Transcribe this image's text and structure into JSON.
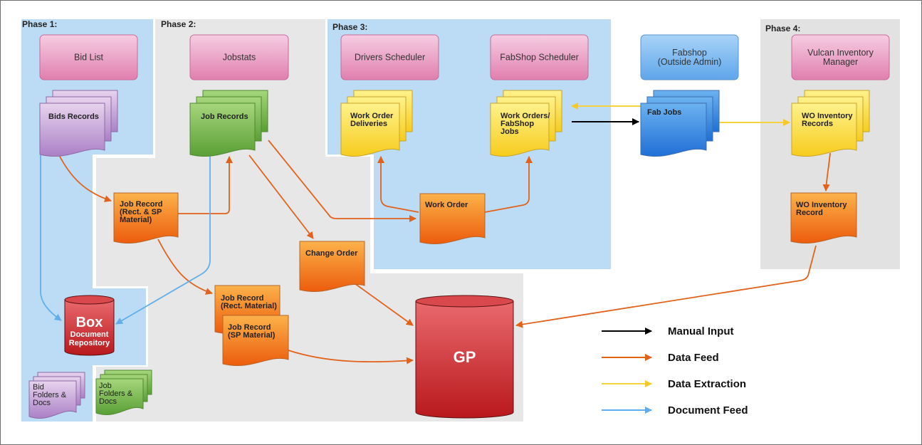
{
  "phases": [
    {
      "id": "phase1",
      "label": "Phase 1:",
      "color": "#bcdcf5"
    },
    {
      "id": "phase2",
      "label": "Phase 2:",
      "color": "#e7e7e7"
    },
    {
      "id": "phase3",
      "label": "Phase 3:",
      "color": "#bcdcf5"
    },
    {
      "id": "phase4",
      "label": "Phase 4:",
      "color": "#e2e2e2"
    }
  ],
  "systems": [
    {
      "id": "bid-list",
      "label": [
        "Bid List"
      ],
      "kind": "pink"
    },
    {
      "id": "jobstats",
      "label": [
        "Jobstats"
      ],
      "kind": "pink"
    },
    {
      "id": "drivers-scheduler",
      "label": [
        "Drivers Scheduler"
      ],
      "kind": "pink"
    },
    {
      "id": "fabshop-scheduler",
      "label": [
        "FabShop Scheduler"
      ],
      "kind": "pink"
    },
    {
      "id": "fabshop",
      "label": [
        "Fabshop",
        "(Outside Admin)"
      ],
      "kind": "blue"
    },
    {
      "id": "vulcan-inventory-manager",
      "label": [
        "Vulcan Inventory",
        "Manager"
      ],
      "kind": "pink"
    }
  ],
  "documents": [
    {
      "id": "bids-records",
      "label": [
        "Bids Records"
      ],
      "kind": "purple",
      "stacked": true
    },
    {
      "id": "job-records",
      "label": [
        "Job Records"
      ],
      "kind": "green",
      "stacked": true
    },
    {
      "id": "work-order-deliveries",
      "label": [
        "Work Order",
        "Deliveries"
      ],
      "kind": "yellow",
      "stacked": true
    },
    {
      "id": "work-orders-fabshop-jobs",
      "label": [
        "Work Orders/",
        "FabShop",
        "Jobs"
      ],
      "kind": "yellow",
      "stacked": true
    },
    {
      "id": "fab-jobs",
      "label": [
        "Fab Jobs"
      ],
      "kind": "blue",
      "stacked": true
    },
    {
      "id": "wo-inventory-records",
      "label": [
        "WO Inventory",
        "Records"
      ],
      "kind": "yellow",
      "stacked": true
    },
    {
      "id": "job-record-rect-sp",
      "label": [
        "Job Record",
        "(Rect. & SP",
        "Material)"
      ],
      "kind": "orange",
      "stacked": false
    },
    {
      "id": "work-order",
      "label": [
        "Work Order"
      ],
      "kind": "orange",
      "stacked": false
    },
    {
      "id": "change-order",
      "label": [
        "Change Order"
      ],
      "kind": "orange",
      "stacked": false
    },
    {
      "id": "job-record-rect",
      "label": [
        "Job Record",
        "(Rect. Material)"
      ],
      "kind": "orange",
      "stacked": false
    },
    {
      "id": "job-record-sp",
      "label": [
        "Job Record",
        "(SP Material)"
      ],
      "kind": "orange",
      "stacked": false
    },
    {
      "id": "wo-inventory-record",
      "label": [
        "WO Inventory",
        "Record"
      ],
      "kind": "orange",
      "stacked": false
    },
    {
      "id": "bid-folders-docs",
      "label": [
        "Bid",
        "Folders &",
        "Docs"
      ],
      "kind": "purple",
      "stacked": true
    },
    {
      "id": "job-folders-docs",
      "label": [
        "Job",
        "Folders &",
        "Docs"
      ],
      "kind": "green",
      "stacked": true
    }
  ],
  "databases": [
    {
      "id": "box-repository",
      "title": "Box",
      "subtitle": [
        "Document",
        "Repository"
      ]
    },
    {
      "id": "gp",
      "title": "GP",
      "subtitle": []
    }
  ],
  "connections": [
    {
      "from": "bids-records",
      "to": "job-record-rect-sp",
      "type": "data-feed"
    },
    {
      "from": "job-record-rect-sp",
      "to": "job-records",
      "type": "data-feed"
    },
    {
      "from": "job-record-rect-sp",
      "to": "job-record-rect",
      "type": "data-feed"
    },
    {
      "from": "job-records",
      "to": "change-order",
      "type": "data-feed"
    },
    {
      "from": "job-records",
      "to": "work-order",
      "type": "data-feed"
    },
    {
      "from": "work-order",
      "to": "work-order-deliveries",
      "type": "data-feed"
    },
    {
      "from": "work-order",
      "to": "work-orders-fabshop-jobs",
      "type": "data-feed"
    },
    {
      "from": "change-order",
      "to": "gp",
      "type": "data-feed"
    },
    {
      "from": "job-record-sp",
      "to": "gp",
      "type": "data-feed"
    },
    {
      "from": "wo-inventory-records",
      "to": "wo-inventory-record",
      "type": "data-feed"
    },
    {
      "from": "wo-inventory-record",
      "to": "gp",
      "type": "data-feed"
    },
    {
      "from": "fab-jobs",
      "to": "work-orders-fabshop-jobs",
      "type": "data-extraction"
    },
    {
      "from": "fab-jobs",
      "to": "wo-inventory-records",
      "type": "data-extraction"
    },
    {
      "from": "work-orders-fabshop-jobs",
      "to": "fab-jobs",
      "type": "manual-input"
    },
    {
      "from": "bids-records",
      "to": "box-repository",
      "type": "document-feed"
    },
    {
      "from": "job-records",
      "to": "box-repository",
      "type": "document-feed"
    }
  ],
  "legend": [
    {
      "type": "manual-input",
      "label": "Manual Input",
      "color": "#000000"
    },
    {
      "type": "data-feed",
      "label": "Data Feed",
      "color": "#e2621b"
    },
    {
      "type": "data-extraction",
      "label": "Data Extraction",
      "color": "#f5d33f"
    },
    {
      "type": "document-feed",
      "label": "Document Feed",
      "color": "#62aeea"
    }
  ],
  "colors": {
    "pink": [
      "#f6cde3",
      "#e07fae",
      "#c96a98"
    ],
    "blue_box": [
      "#a9d3f7",
      "#5ea6ea",
      "#5a93d0"
    ],
    "purple": [
      "#e7d3ee",
      "#ab80c6",
      "#8d6aa6"
    ],
    "green": [
      "#a6d67c",
      "#5a9f35",
      "#4e8a31"
    ],
    "yellow": [
      "#fff28c",
      "#f6cc1d",
      "#c9a42a"
    ],
    "blue_doc": [
      "#6cb2f0",
      "#1f6fd6",
      "#3a6fb0"
    ],
    "orange": [
      "#fcb24a",
      "#ec5c0c",
      "#b6642a"
    ],
    "db_red": [
      "#ea6a6e",
      "#b8181c",
      "#5a1010"
    ]
  }
}
